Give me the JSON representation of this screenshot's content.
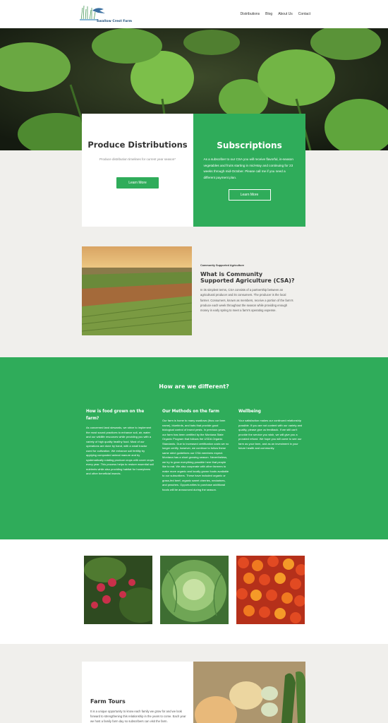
{
  "brand": {
    "name": "Swallow Crest Farm"
  },
  "nav": [
    {
      "label": "Distributions"
    },
    {
      "label": "Blog"
    },
    {
      "label": "About Us"
    },
    {
      "label": "Contact"
    }
  ],
  "produce": {
    "title": "Produce Distributions",
    "subtitle": "Produce distribution timelines for current year season*",
    "button": "Learn More"
  },
  "subscriptions": {
    "title": "Subscriptions",
    "text": "As a subscriber to our CSA you will receive flavorful, in-season vegetables and fruits starting in mid-May and continuing for 23 weeks through mid-October. Please call me if you need a different payment plan.",
    "button": "Learn More"
  },
  "csa": {
    "kicker": "Community Supported Agriculture",
    "title": "What is Community Supported Agriculture (CSA)?",
    "text": "In its simplest terms, CSA consists of a partnership between an agricultural producer and its consumers. The producer is the local farmer. Consumers, known as members, receive a portion of the farm's produce each week throughout the season while providing enough money in early spring to meet a farm's operating expense."
  },
  "different": {
    "title": "How are we different?",
    "columns": [
      {
        "heading": "How is food grown on the farm?",
        "text": "As concerned land stewards, we strive to implement the most sound practices to enhance soil, air, water and our wildlife resources while providing you with a variety of high quality healthy food. Most of our operations are done by hand, with a small tractor used for cultivation. We enhance soil fertility by applying composted animal manure and by systematically rotating produce crops with cover crops every year. This process helps to restore essential soil nutrients while also providing habitat for honeybees and other beneficial insects."
      },
      {
        "heading": "Our Methods on the farm",
        "text": "Our farm is home to many swallows (thus our farm name), bluebirds, and bats that provide good biological control of insect pests. In previous years, our farm has been certified by the Montana State Organic Program that follows the USDA Organic Standards. Due to increased certification costs we no longer certify, however, we continue to follow these same strict guidelines our CSA members expect. Montana has a short growing season. Nevertheless, we try to grow everything possible here that people like to eat. We also cooperate with other farmers to make more organic and locally grown foods available to our subscribers. These have included organic or grass-fed beef, organic sweet cherries, nectarines, and peaches. Opportunities to purchase additional foods will be announced during the season."
      },
      {
        "heading": "Wellbeing",
        "text": "Your satisfaction makes our continued relationship possible. If you are not content with our variety and quality, please give us feedback. If we still can't provide the service you wish, we will give you a prorated refund. We hope you will come to see our farm as your farm, and as an investment in your future health and community."
      }
    ]
  },
  "tours": {
    "title": "Farm Tours",
    "text": "It is a unique opportunity to know each family we grow for and we look forward to strengthening this relationship in the years to come. Each year we host a family farm day so subscribers can visit the farm."
  },
  "colors": {
    "accent": "#2fac5a",
    "band": "#f0efec"
  },
  "icons": {
    "logo": "swallow-grass-logo-icon"
  }
}
